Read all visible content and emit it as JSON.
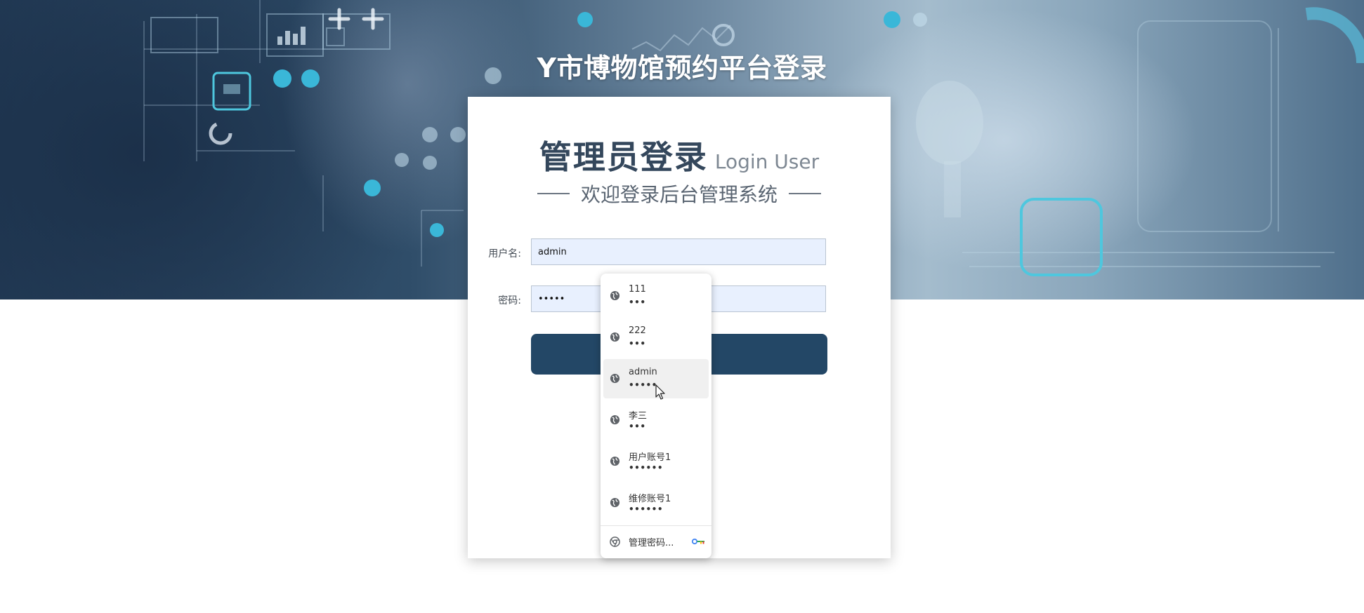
{
  "page": {
    "title": "Y市博物馆预约平台登录"
  },
  "card": {
    "heading": "管理员登录",
    "heading_en": "Login User",
    "subtitle": "欢迎登录后台管理系统"
  },
  "form": {
    "username_label": "用户名:",
    "username_value": "admin",
    "password_label": "密码:",
    "password_value": "admin",
    "login_button_label": ""
  },
  "autofill": {
    "items": [
      {
        "username": "111",
        "password_mask": "•••"
      },
      {
        "username": "222",
        "password_mask": "•••"
      },
      {
        "username": "admin",
        "password_mask": "•••••"
      },
      {
        "username": "李三",
        "password_mask": "•••"
      },
      {
        "username": "用户账号1",
        "password_mask": "••••••"
      },
      {
        "username": "维修账号1",
        "password_mask": "••••••"
      }
    ],
    "highlighted_index": 2,
    "manage_label": "管理密码..."
  },
  "colors": {
    "banner_dark": "#223a55",
    "accent_button": "#234766",
    "input_autofill_bg": "#e8f0fe",
    "heading_text": "#34475c"
  },
  "icons": {
    "autofill_item": "globe-icon",
    "manage": "chrome-icon",
    "manage_key": "key-icon"
  }
}
